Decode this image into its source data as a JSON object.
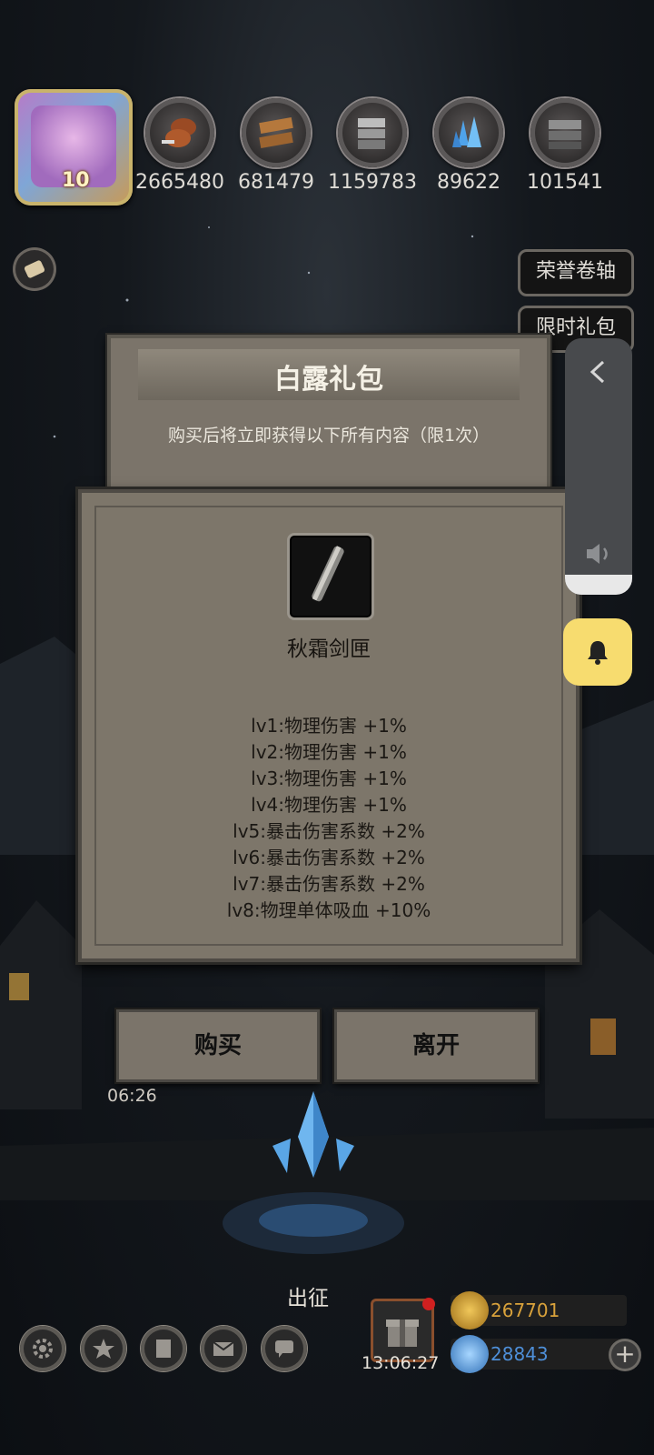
{
  "resources": [
    {
      "icon": "meat-icon",
      "value": "2665480"
    },
    {
      "icon": "wood-icon",
      "value": "681479"
    },
    {
      "icon": "iron-icon",
      "value": "1159783"
    },
    {
      "icon": "crystal-icon",
      "value": "89622"
    },
    {
      "icon": "steel-icon",
      "value": "101541"
    }
  ],
  "avatar": {
    "level": "10"
  },
  "side_buttons": {
    "honor_scroll": "荣誉卷轴",
    "limited_pack": "限时礼包"
  },
  "pack_dialog": {
    "title": "白露礼包",
    "subtitle": "购买后将立即获得以下所有内容（限1次）"
  },
  "item_dialog": {
    "item_name": "秋霜剑匣",
    "effects": [
      "lv1:物理伤害 +1%",
      "lv2:物理伤害 +1%",
      "lv3:物理伤害 +1%",
      "lv4:物理伤害 +1%",
      "lv5:暴击伤害系数 +2%",
      "lv6:暴击伤害系数 +2%",
      "lv7:暴击伤害系数 +2%",
      "lv8:物理单体吸血 +10%"
    ]
  },
  "buttons": {
    "buy": "购买",
    "leave": "离开"
  },
  "timer_left": "06:26",
  "expedition_label": "出征",
  "gift_timer": "13:06:27",
  "currency": {
    "gold": "267701",
    "gem": "28843"
  },
  "colors": {
    "panel": "#7d766a",
    "gold": "#c89a2c",
    "gem": "#5aa0e6",
    "bell": "#f7dc6f"
  }
}
